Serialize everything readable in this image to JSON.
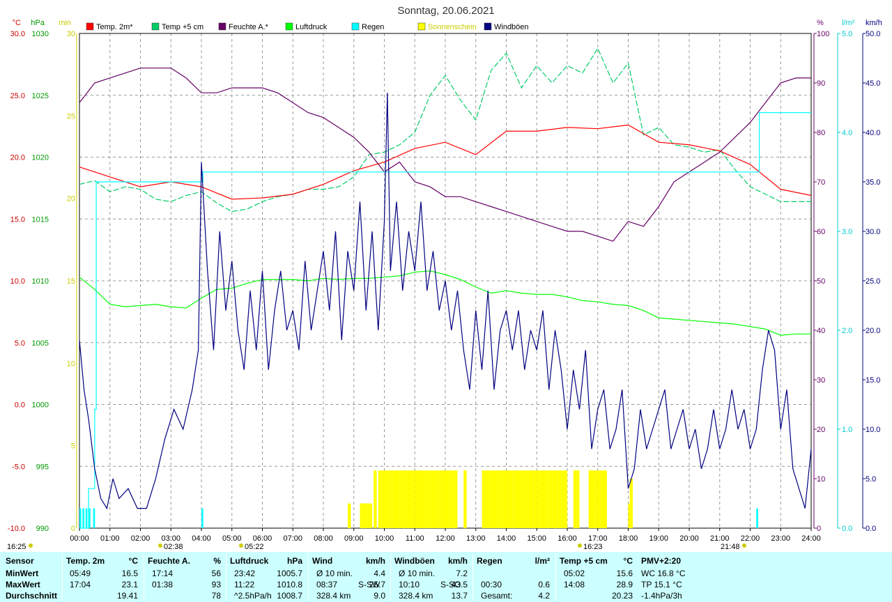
{
  "chart_data": {
    "type": "line",
    "title": "Sonntag, 20.06.2021",
    "x_ticks": [
      "00:00",
      "01:00",
      "02:00",
      "03:00",
      "04:00",
      "05:00",
      "06:00",
      "07:00",
      "08:00",
      "09:00",
      "10:00",
      "11:00",
      "12:00",
      "13:00",
      "14:00",
      "15:00",
      "16:00",
      "17:00",
      "18:00",
      "19:00",
      "20:00",
      "21:00",
      "22:00",
      "23:00",
      "24:00"
    ],
    "axes": {
      "temp": {
        "unit": "°C",
        "color": "#cc0000",
        "min": -10,
        "max": 30,
        "ticks": [
          "30.0",
          "25.0",
          "20.0",
          "15.0",
          "10.0",
          "5.0",
          "0.0",
          "-5.0",
          "-10.0"
        ]
      },
      "pressure": {
        "unit": "hPa",
        "color": "#009900",
        "min": 990,
        "max": 1030,
        "ticks": [
          "1030",
          "1025",
          "1020",
          "1015",
          "1010",
          "1005",
          "1000",
          "995",
          "990"
        ]
      },
      "sunshine": {
        "unit": "min",
        "color": "#cccc00",
        "min": 0,
        "max": 30,
        "ticks": [
          "30",
          "25",
          "20",
          "15",
          "10",
          "5",
          "0"
        ]
      },
      "humidity": {
        "unit": "%",
        "color": "#660066",
        "min": 0,
        "max": 100,
        "ticks": [
          "100",
          "90",
          "80",
          "70",
          "60",
          "50",
          "40",
          "30",
          "20",
          "10",
          "0"
        ]
      },
      "rain": {
        "unit": "l/m²",
        "color": "#00cccc",
        "min": 0,
        "max": 5,
        "ticks": [
          "5.0",
          "4.0",
          "3.0",
          "2.0",
          "1.0",
          "0.0"
        ]
      },
      "wind": {
        "unit": "km/h",
        "color": "#000080",
        "min": 0,
        "max": 50,
        "ticks": [
          "50.0",
          "45.0",
          "40.0",
          "35.0",
          "30.0",
          "25.0",
          "20.0",
          "15.0",
          "10.0",
          "5.0",
          "0.0"
        ]
      }
    },
    "legend": [
      {
        "name": "Temp. 2m*",
        "color": "#ff0000"
      },
      {
        "name": "Temp +5 cm",
        "color": "#00cc66"
      },
      {
        "name": "Feuchte A.*",
        "color": "#660066"
      },
      {
        "name": "Luftdruck",
        "color": "#00ff00"
      },
      {
        "name": "Regen",
        "color": "#00ffff"
      },
      {
        "name": "Sonnenschein",
        "color": "#ffff00"
      },
      {
        "name": "Windböen",
        "color": "#000080"
      }
    ],
    "series": {
      "temp2m": {
        "axis": "temp",
        "color": "#ff0000",
        "x": [
          0,
          1,
          2,
          3,
          4,
          5,
          6,
          7,
          8,
          9,
          10,
          11,
          12,
          13,
          14,
          15,
          16,
          17,
          18,
          19,
          20,
          21,
          22,
          23,
          24
        ],
        "y": [
          19.2,
          18.4,
          17.6,
          18.0,
          17.6,
          16.6,
          16.7,
          17.0,
          17.8,
          18.9,
          19.6,
          20.7,
          21.2,
          20.2,
          22.1,
          22.1,
          22.4,
          22.3,
          22.6,
          21.2,
          21.0,
          20.5,
          19.4,
          17.4,
          16.9
        ]
      },
      "temp5cm": {
        "axis": "temp",
        "color": "#00cc66",
        "dashed": true,
        "x": [
          0,
          0.5,
          1,
          1.5,
          2,
          2.5,
          3,
          3.5,
          4,
          4.5,
          5,
          5.5,
          6,
          6.5,
          7,
          7.5,
          8,
          8.5,
          9,
          9.5,
          10,
          10.5,
          11,
          11.5,
          12,
          12.5,
          13,
          13.5,
          14,
          14.5,
          15,
          15.5,
          16,
          16.5,
          17,
          17.5,
          18,
          18.5,
          19,
          19.5,
          20,
          20.5,
          21,
          21.5,
          22,
          22.5,
          23,
          23.5,
          24
        ],
        "y": [
          17.8,
          18.1,
          17.2,
          17.6,
          17.4,
          16.6,
          16.4,
          16.9,
          17.2,
          16.3,
          15.6,
          15.8,
          16.4,
          16.8,
          17.0,
          17.4,
          17.4,
          17.6,
          18.4,
          20.2,
          20.4,
          21.0,
          22.0,
          25.0,
          26.6,
          24.6,
          23.0,
          27.0,
          28.4,
          25.6,
          27.4,
          26.0,
          27.4,
          26.8,
          28.8,
          26.0,
          27.6,
          21.8,
          22.4,
          21.0,
          20.8,
          20.4,
          20.6,
          19.0,
          17.6,
          17.0,
          16.4,
          16.4,
          16.4
        ]
      },
      "humidity": {
        "axis": "humidity",
        "color": "#660066",
        "x": [
          0,
          0.5,
          1,
          1.5,
          2,
          2.5,
          3,
          3.5,
          4,
          4.5,
          5,
          5.5,
          6,
          6.5,
          7,
          7.5,
          8,
          8.5,
          9,
          9.5,
          10,
          10.5,
          11,
          11.5,
          12,
          12.5,
          13,
          13.5,
          14,
          14.5,
          15,
          15.5,
          16,
          16.5,
          17,
          17.5,
          18,
          18.5,
          19,
          19.5,
          20,
          20.5,
          21,
          21.5,
          22,
          22.5,
          23,
          23.5,
          24
        ],
        "y": [
          86,
          90,
          91,
          92,
          93,
          93,
          93,
          91,
          88,
          88,
          89,
          89,
          89,
          88,
          86,
          84,
          83,
          81,
          79,
          76,
          72,
          74,
          70,
          69,
          67,
          67,
          66,
          65,
          64,
          63,
          62,
          61,
          60,
          60,
          59,
          58,
          62,
          61,
          65,
          70,
          72,
          74,
          76,
          79,
          82,
          86,
          90,
          91,
          91
        ]
      },
      "pressure": {
        "axis": "pressure",
        "color": "#00ff00",
        "x": [
          0,
          0.5,
          1,
          1.5,
          2,
          2.5,
          3,
          3.5,
          4,
          4.5,
          5,
          5.5,
          6,
          6.5,
          7,
          7.5,
          8,
          8.5,
          9,
          9.5,
          10,
          10.5,
          11,
          11.5,
          12,
          12.5,
          13,
          13.5,
          14,
          14.5,
          15,
          15.5,
          16,
          16.5,
          17,
          17.5,
          18,
          18.5,
          19,
          19.5,
          20,
          20.5,
          21,
          21.5,
          22,
          22.5,
          23,
          23.5,
          24
        ],
        "y": [
          1010.3,
          1009.3,
          1008.1,
          1007.9,
          1008.0,
          1008.1,
          1007.9,
          1007.8,
          1008.6,
          1009.3,
          1009.4,
          1009.8,
          1010.1,
          1010.1,
          1010.1,
          1010.0,
          1010.2,
          1010.1,
          1010.2,
          1010.2,
          1010.3,
          1010.4,
          1010.7,
          1010.8,
          1010.5,
          1010.1,
          1009.5,
          1009.0,
          1009.2,
          1009.0,
          1008.9,
          1008.9,
          1008.7,
          1008.4,
          1008.3,
          1008.1,
          1008.0,
          1007.6,
          1007.0,
          1006.9,
          1006.8,
          1006.7,
          1006.6,
          1006.5,
          1006.3,
          1006.1,
          1005.6,
          1005.7,
          1005.7
        ]
      },
      "rain_cumulative": {
        "axis": "rain",
        "color": "#00ffff",
        "x": [
          0,
          0.1,
          0.3,
          0.5,
          0.55,
          4.0,
          4.05,
          22.1,
          22.3,
          24
        ],
        "y": [
          0,
          0,
          0.4,
          1.2,
          3.5,
          3.5,
          3.6,
          3.6,
          4.2,
          4.2
        ]
      },
      "rain_bars": {
        "axis": "rain",
        "color": "#00ffff",
        "x": [
          0.0,
          0.1,
          0.2,
          0.3,
          0.45,
          4.0,
          22.2
        ],
        "y": [
          0.2,
          0.2,
          0.2,
          0.2,
          0.2,
          0.2,
          0.2
        ]
      },
      "sunshine_bars": {
        "axis": "sunshine",
        "color": "#ffff00",
        "x": [
          8.8,
          9.2,
          9.3,
          9.4,
          9.5,
          9.65,
          9.8,
          9.9,
          10.0,
          10.1,
          10.2,
          10.3,
          10.4,
          10.5,
          10.6,
          10.7,
          10.8,
          10.9,
          11.0,
          11.1,
          11.2,
          11.3,
          11.4,
          11.5,
          11.6,
          11.7,
          11.8,
          11.9,
          12.0,
          12.1,
          12.2,
          12.3,
          12.6,
          13.2,
          13.3,
          13.4,
          13.5,
          13.6,
          13.7,
          13.8,
          13.9,
          14.0,
          14.1,
          14.2,
          14.3,
          14.4,
          14.5,
          14.6,
          14.7,
          14.8,
          14.9,
          15.0,
          15.1,
          15.2,
          15.3,
          15.4,
          15.5,
          15.6,
          15.7,
          15.8,
          15.9,
          16.2,
          16.3,
          16.7,
          16.8,
          16.9,
          17.0,
          17.1,
          17.2,
          18.0,
          18.05
        ],
        "y": [
          1.5,
          1.5,
          1.5,
          1.5,
          1.5,
          3.5,
          3.5,
          3.5,
          3.5,
          3.5,
          3.5,
          3.5,
          3.5,
          3.5,
          3.5,
          3.5,
          3.5,
          3.5,
          3.5,
          3.5,
          3.5,
          3.5,
          3.5,
          3.5,
          3.5,
          3.5,
          3.5,
          3.5,
          3.5,
          3.5,
          3.5,
          3.5,
          3.5,
          3.5,
          3.5,
          3.5,
          3.5,
          3.5,
          3.5,
          3.5,
          3.5,
          3.5,
          3.5,
          3.5,
          3.5,
          3.5,
          3.5,
          3.5,
          3.5,
          3.5,
          3.5,
          3.5,
          3.5,
          3.5,
          3.5,
          3.5,
          3.5,
          3.5,
          3.5,
          3.5,
          3.5,
          3.5,
          3.5,
          3.5,
          3.5,
          3.5,
          3.5,
          3.5,
          3.5,
          1.5,
          3.0
        ]
      },
      "gusts": {
        "axis": "wind",
        "color": "#000080",
        "x": [
          0,
          0.15,
          0.3,
          0.5,
          0.7,
          0.9,
          1.1,
          1.3,
          1.6,
          1.9,
          2.2,
          2.5,
          2.8,
          3.1,
          3.4,
          3.7,
          3.9,
          4.0,
          4.2,
          4.4,
          4.6,
          4.8,
          5.0,
          5.2,
          5.4,
          5.6,
          5.8,
          6.0,
          6.2,
          6.4,
          6.6,
          6.8,
          7.0,
          7.2,
          7.4,
          7.6,
          7.8,
          8.0,
          8.2,
          8.4,
          8.6,
          8.8,
          9.0,
          9.2,
          9.4,
          9.6,
          9.8,
          10.0,
          10.1,
          10.2,
          10.4,
          10.6,
          10.8,
          11.0,
          11.2,
          11.4,
          11.6,
          11.8,
          12.0,
          12.2,
          12.4,
          12.6,
          12.8,
          13.0,
          13.2,
          13.4,
          13.6,
          13.8,
          14.0,
          14.2,
          14.4,
          14.6,
          14.8,
          15.0,
          15.2,
          15.4,
          15.6,
          15.8,
          16.0,
          16.2,
          16.4,
          16.6,
          16.8,
          17.0,
          17.2,
          17.4,
          17.6,
          17.8,
          18.0,
          18.2,
          18.4,
          18.6,
          18.8,
          19.0,
          19.2,
          19.4,
          19.6,
          19.8,
          20.0,
          20.2,
          20.4,
          20.6,
          20.8,
          21.0,
          21.2,
          21.4,
          21.6,
          21.8,
          22.0,
          22.2,
          22.4,
          22.6,
          22.8,
          23.0,
          23.2,
          23.4,
          23.6,
          23.8,
          24.0
        ],
        "y": [
          19,
          14,
          11,
          6,
          3,
          2,
          5,
          3,
          4,
          2,
          2,
          5,
          9,
          12,
          10,
          14,
          18,
          37,
          26,
          18,
          30,
          22,
          27,
          20,
          16,
          24,
          18,
          26,
          16,
          22,
          26,
          20,
          22,
          18,
          27,
          20,
          24,
          28,
          22,
          30,
          19,
          28,
          24,
          33,
          22,
          30,
          20,
          31,
          44,
          26,
          33,
          24,
          30,
          26,
          33,
          24,
          28,
          22,
          25,
          20,
          24,
          18,
          14,
          22,
          16,
          24,
          14,
          20,
          22,
          18,
          22,
          16,
          20,
          18,
          22,
          14,
          20,
          16,
          10,
          16,
          12,
          18,
          8,
          12,
          14,
          8,
          10,
          14,
          4,
          6,
          12,
          8,
          10,
          12,
          14,
          8,
          10,
          12,
          8,
          10,
          6,
          8,
          12,
          8,
          10,
          14,
          10,
          12,
          8,
          10,
          16,
          20,
          18,
          10,
          14,
          6,
          4,
          2,
          8,
          12,
          6,
          12
        ]
      }
    }
  },
  "stats": {
    "col_sensor": {
      "title": "Sensor",
      "rows": [
        "MinWert",
        "MaxWert",
        "Durchschnitt"
      ]
    },
    "col_temp": {
      "title": "Temp. 2m",
      "unit": "°C",
      "times": [
        "05:49",
        "17:04",
        ""
      ],
      "values": [
        "16.5",
        "23.1",
        "19.41"
      ]
    },
    "col_hum": {
      "title": "Feuchte A.",
      "unit": "%",
      "times": [
        "17:14",
        "01:38",
        ""
      ],
      "values": [
        "56",
        "93",
        "78"
      ]
    },
    "col_press": {
      "title": "Luftdruck",
      "unit": "hPa",
      "times": [
        "23:42",
        "11:22",
        "^2.5hPa/h"
      ],
      "values": [
        "1005.7",
        "1010.8",
        "1008.7"
      ]
    },
    "col_wind": {
      "title": "Wind",
      "unit": "km/h",
      "times": [
        "Ø 10 min.",
        "08:37",
        "328.4 km"
      ],
      "mid": [
        "",
        "S-SW",
        ""
      ],
      "values": [
        "4.4",
        "25.7",
        "9.0"
      ]
    },
    "col_gust": {
      "title": "Windböen",
      "unit": "km/h",
      "times": [
        "Ø 10 min.",
        "10:10",
        "328.4 km"
      ],
      "mid": [
        "",
        "S-SO",
        ""
      ],
      "values": [
        "7.2",
        "43.5",
        "13.7"
      ]
    },
    "col_rain": {
      "title": "Regen",
      "unit": "l/m²",
      "times": [
        "",
        "00:30",
        "Gesamt:"
      ],
      "values": [
        "",
        "0.6",
        "4.2"
      ]
    },
    "col_temp5": {
      "title": "Temp +5 cm",
      "unit": "°C",
      "times": [
        "05:02",
        "14:08",
        ""
      ],
      "values": [
        "15.6",
        "28.9",
        "20.23"
      ]
    },
    "col_pmv": {
      "title": "PMV+2:20",
      "rows": [
        "WC 16.8 °C",
        "TP 15.1 °C",
        "-1.4hPa/3h"
      ]
    }
  },
  "sun_events": {
    "sunrise_label": "16:25",
    "sunset_label": "21:48",
    "moon_markers": [
      "02:38",
      "05:22",
      "16:23"
    ]
  }
}
